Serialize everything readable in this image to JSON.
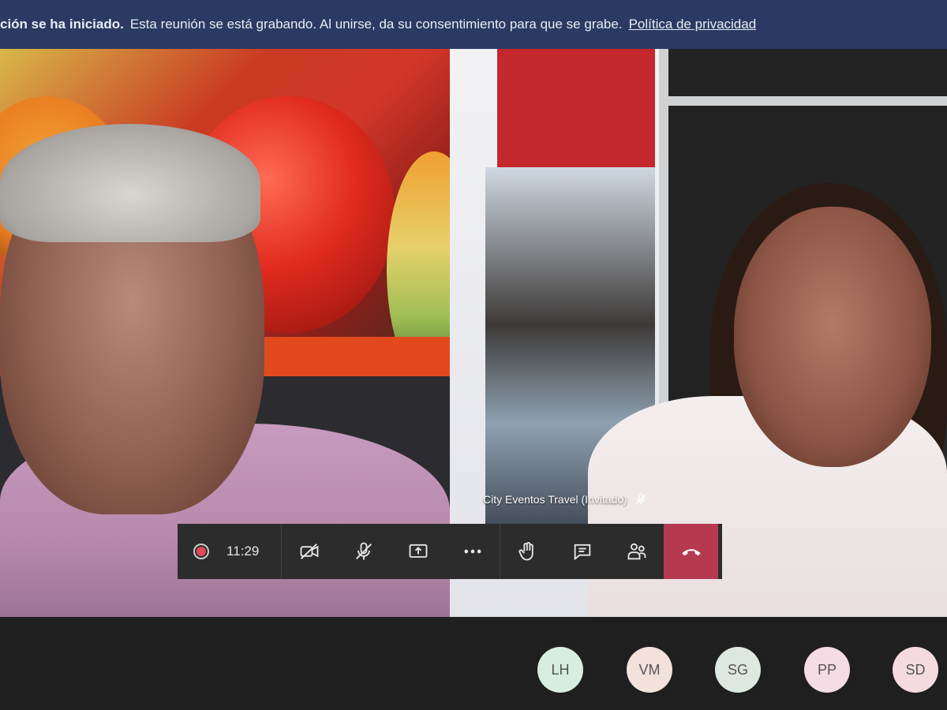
{
  "banner": {
    "bold_text": "ción se ha iniciado.",
    "text": "Esta reunión se está grabando. Al unirse, da su consentimiento para que se grabe.",
    "link": "Política de privacidad",
    "background": "#2b3a62"
  },
  "tiles": {
    "right_participant_label": "City Eventos Travel (Invitado)",
    "right_participant_status_icon": "mic-off-icon"
  },
  "controls": {
    "recording_icon": "record-icon",
    "timer": "11:29",
    "buttons": [
      {
        "name": "camera-off",
        "icon": "video-off-icon"
      },
      {
        "name": "mic-off",
        "icon": "mic-off-icon"
      },
      {
        "name": "share-screen",
        "icon": "share-icon"
      },
      {
        "name": "more",
        "icon": "more-icon"
      },
      {
        "name": "raise-hand",
        "icon": "hand-icon"
      },
      {
        "name": "chat",
        "icon": "chat-icon"
      },
      {
        "name": "participants",
        "icon": "people-icon"
      },
      {
        "name": "hang-up",
        "icon": "phone-hangup-icon"
      }
    ],
    "hangup_color": "#b53a50"
  },
  "participants": [
    {
      "initials": "LH",
      "color": "#d7ede0"
    },
    {
      "initials": "VM",
      "color": "#f3e1dc"
    },
    {
      "initials": "SG",
      "color": "#dde9e0"
    },
    {
      "initials": "PP",
      "color": "#f5dbe3"
    },
    {
      "initials": "SD",
      "color": "#f5dbe0"
    }
  ]
}
